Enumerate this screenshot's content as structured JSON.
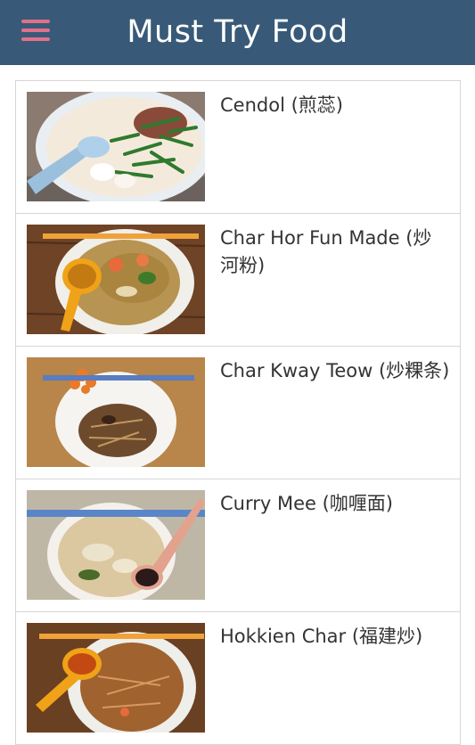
{
  "header": {
    "title": "Must Try Food",
    "menu_icon": "hamburger-menu-icon"
  },
  "colors": {
    "header_bg": "#385a78",
    "menu_icon": "#e3708a"
  },
  "foods": [
    {
      "name": "Cendol (煎蕊)"
    },
    {
      "name": "Char Hor Fun Made (炒河粉)"
    },
    {
      "name": "Char Kway Teow (炒粿条)"
    },
    {
      "name": "Curry Mee (咖喱面)"
    },
    {
      "name": "Hokkien Char (福建炒)"
    }
  ]
}
